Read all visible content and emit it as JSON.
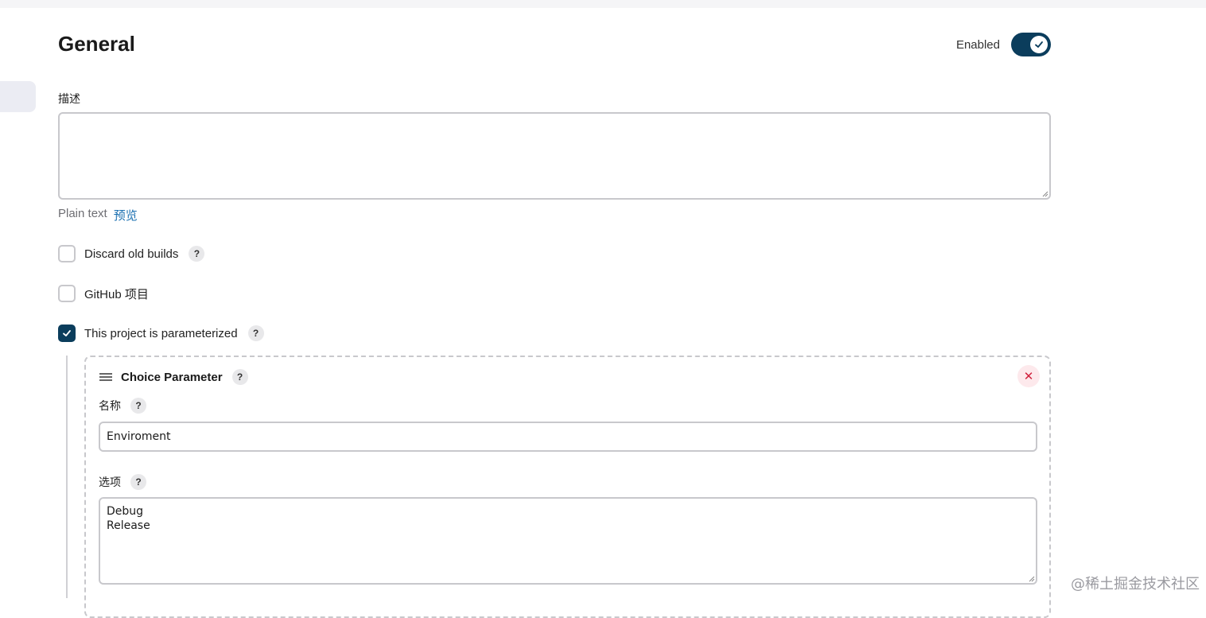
{
  "section": {
    "title": "General",
    "enabled_label": "Enabled",
    "enabled": true
  },
  "description": {
    "label": "描述",
    "value": "",
    "plain_text": "Plain text",
    "preview_link": "预览"
  },
  "options": [
    {
      "label": "Discard old builds",
      "checked": false,
      "has_help": true
    },
    {
      "label": "GitHub 项目",
      "checked": false,
      "has_help": false
    },
    {
      "label": "This project is parameterized",
      "checked": true,
      "has_help": true
    }
  ],
  "parameter": {
    "title": "Choice Parameter",
    "name_label": "名称",
    "name_value": "Enviroment",
    "choices_label": "选项",
    "choices": [
      "Debug",
      "Release"
    ]
  },
  "help_symbol": "?",
  "watermark": "@稀土掘金技术社区",
  "colors": {
    "accent": "#0b3d5c",
    "link": "#1a6fb0",
    "remove": "#d0213c",
    "border": "#c8c8cc"
  },
  "icons": {
    "toggle": "check-icon",
    "drag": "drag-handle-icon",
    "remove": "close-icon",
    "help": "help-icon"
  }
}
